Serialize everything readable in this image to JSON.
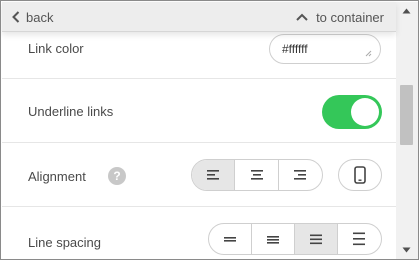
{
  "topbar": {
    "back_label": "back",
    "to_container_label": "to container"
  },
  "link_color": {
    "label": "Link color",
    "value": "#ffffff"
  },
  "underline_links": {
    "label": "Underline links",
    "enabled": true
  },
  "alignment": {
    "label": "Alignment",
    "help_glyph": "?",
    "options": [
      "align-left-icon",
      "align-center-icon",
      "align-right-icon"
    ],
    "selected": "align-left-icon",
    "mobile_icon": "mobile-phone-icon"
  },
  "line_spacing": {
    "label": "Line spacing",
    "options": [
      "spacing-compact-icon",
      "spacing-tight-icon",
      "spacing-normal-icon",
      "spacing-wide-icon"
    ],
    "selected": "spacing-normal-icon"
  },
  "colors": {
    "toggle_on": "#34c759",
    "topbar_bg": "#ededed",
    "active_segment": "#e6e6e6"
  }
}
